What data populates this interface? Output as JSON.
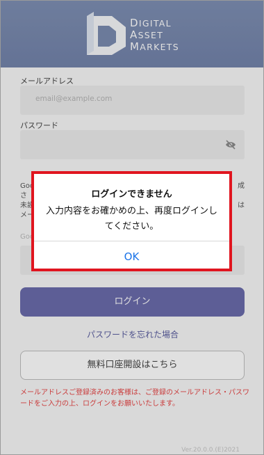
{
  "header": {
    "logo_line1_cap": "D",
    "logo_line1_rest": "IGITAL",
    "logo_line2_cap": "A",
    "logo_line2_rest": "SSET",
    "logo_line3_cap": "M",
    "logo_line3_rest": "ARKETS"
  },
  "form": {
    "email_label": "メールアドレス",
    "email_placeholder": "email@example.com",
    "password_label": "パスワード",
    "auth_text_line1": "Goo",
    "auth_text_line1_right": "成",
    "auth_text_line2": "さ",
    "auth_text_line3": "未設",
    "auth_text_line3_right": "は",
    "auth_text_line4": "メー",
    "code_label_partial": "Goo",
    "login_button": "ログイン",
    "forgot_link": "パスワードを忘れた場合",
    "open_account_button": "無料口座開設はこちら",
    "notice": "メールアドレスご登録済みのお客様は、ご登録のメールアドレス・パスワードをご入力の上、ログインをお願いいたします。",
    "version": "Ver.20.0.0.(E)2021"
  },
  "dialog": {
    "title": "ログインできません",
    "message": "入力内容をお確かめの上、再度ログインしてください。",
    "ok_label": "OK"
  },
  "colors": {
    "header": "#7383aa",
    "login_button": "#6a6bab",
    "highlight_border": "#e0151f",
    "ok": "#1a73e8",
    "notice": "#e64545"
  },
  "icons": {
    "logo": "digital-asset-markets-logo",
    "password_toggle": "eye-slash-icon"
  }
}
